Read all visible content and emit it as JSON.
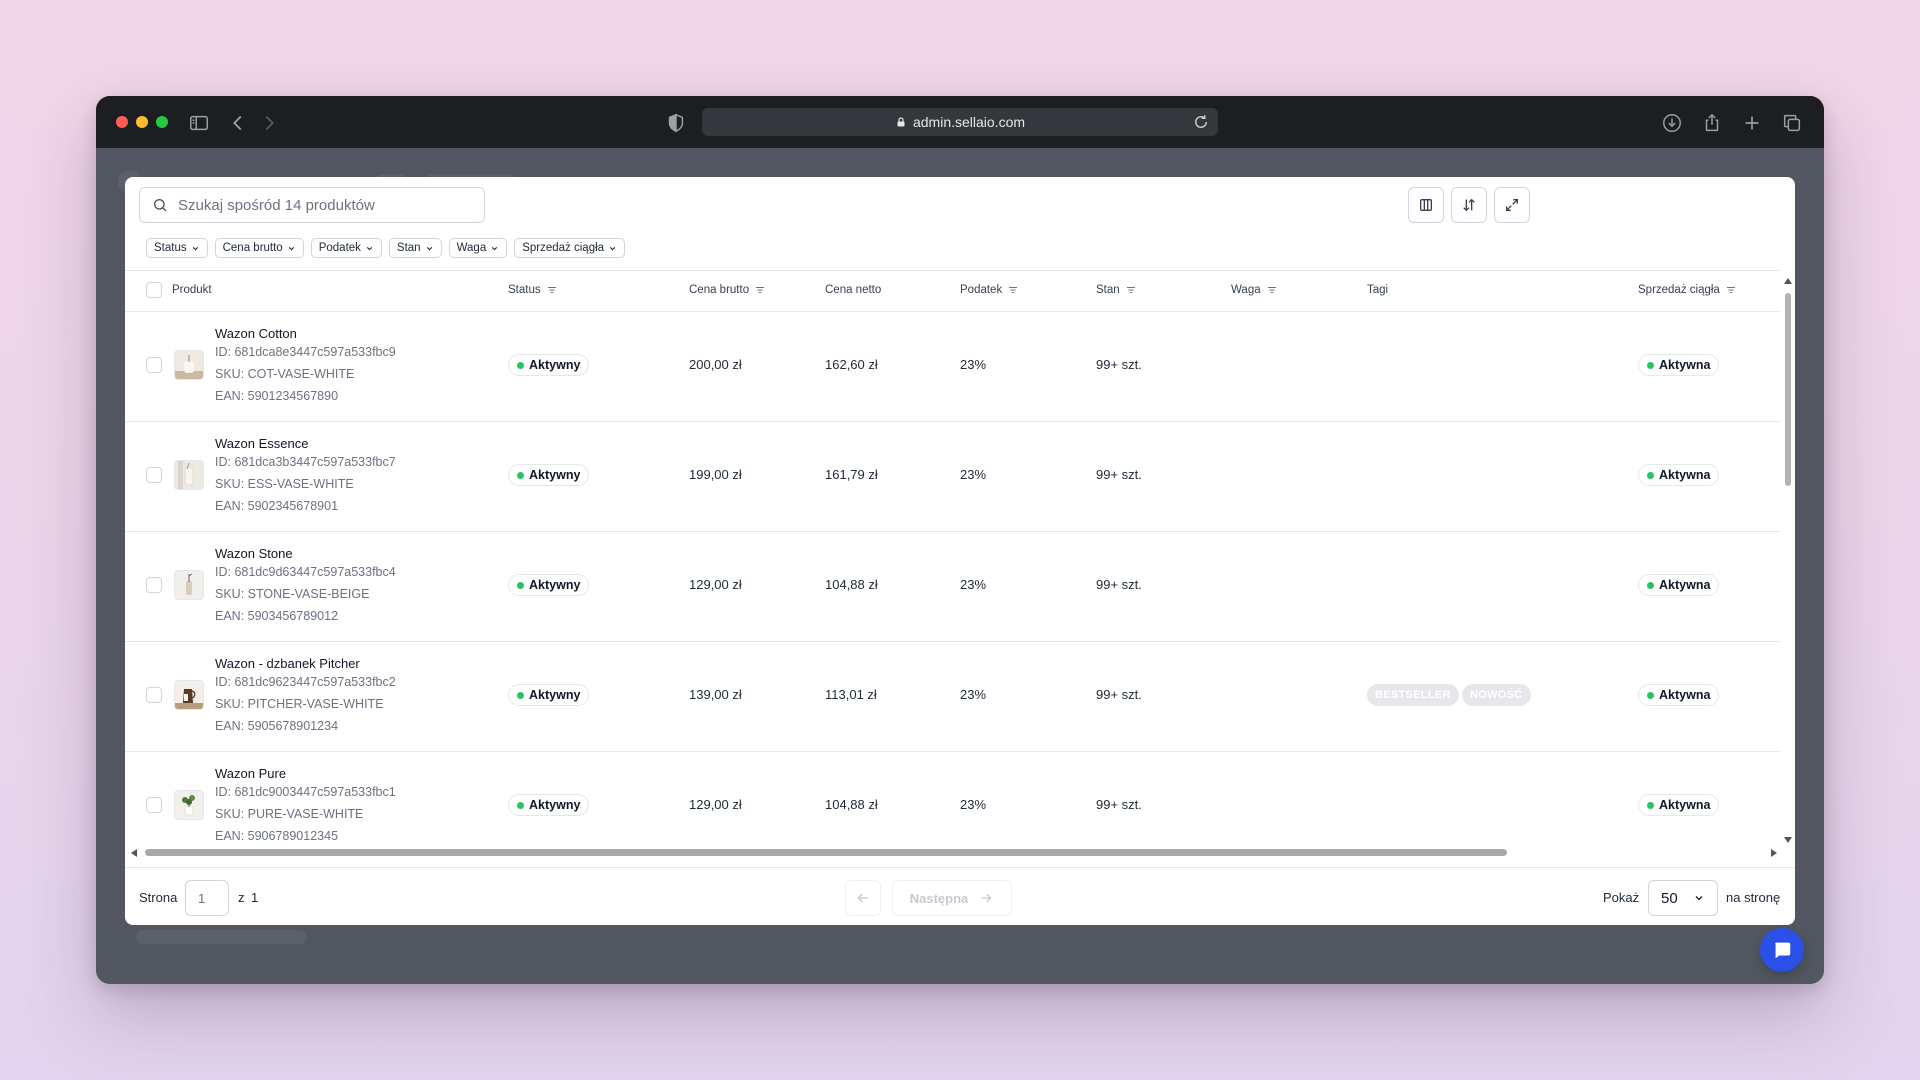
{
  "browser": {
    "url": "admin.sellaio.com"
  },
  "toolbar": {
    "search_placeholder": "Szukaj spośród 14 produktów"
  },
  "filters": [
    "Status",
    "Cena brutto",
    "Podatek",
    "Stan",
    "Waga",
    "Sprzedaż ciągła"
  ],
  "columns": {
    "product": "Produkt",
    "status": "Status",
    "gross": "Cena brutto",
    "net": "Cena netto",
    "tax": "Podatek",
    "stock": "Stan",
    "weight": "Waga",
    "tags": "Tagi",
    "continuous": "Sprzedaż ciągła"
  },
  "rows": [
    {
      "name": "Wazon Cotton",
      "id": "ID: 681dca8e3447c597a533fbc9",
      "sku": "SKU: COT-VASE-WHITE",
      "ean": "EAN: 5901234567890",
      "status": "Aktywny",
      "gross": "200,00 zł",
      "net": "162,60 zł",
      "tax": "23%",
      "stock": "99+ szt.",
      "continuous": "Aktywna",
      "tags": []
    },
    {
      "name": "Wazon Essence",
      "id": "ID: 681dca3b3447c597a533fbc7",
      "sku": "SKU: ESS-VASE-WHITE",
      "ean": "EAN: 5902345678901",
      "status": "Aktywny",
      "gross": "199,00 zł",
      "net": "161,79 zł",
      "tax": "23%",
      "stock": "99+ szt.",
      "continuous": "Aktywna",
      "tags": []
    },
    {
      "name": "Wazon Stone",
      "id": "ID: 681dc9d63447c597a533fbc4",
      "sku": "SKU: STONE-VASE-BEIGE",
      "ean": "EAN: 5903456789012",
      "status": "Aktywny",
      "gross": "129,00 zł",
      "net": "104,88 zł",
      "tax": "23%",
      "stock": "99+ szt.",
      "continuous": "Aktywna",
      "tags": []
    },
    {
      "name": "Wazon - dzbanek Pitcher",
      "id": "ID: 681dc9623447c597a533fbc2",
      "sku": "SKU: PITCHER-VASE-WHITE",
      "ean": "EAN: 5905678901234",
      "status": "Aktywny",
      "gross": "139,00 zł",
      "net": "113,01 zł",
      "tax": "23%",
      "stock": "99+ szt.",
      "continuous": "Aktywna",
      "tags": [
        "BESTSELLER",
        "NOWOŚĆ"
      ]
    },
    {
      "name": "Wazon Pure",
      "id": "ID: 681dc9003447c597a533fbc1",
      "sku": "SKU: PURE-VASE-WHITE",
      "ean": "EAN: 5906789012345",
      "status": "Aktywny",
      "gross": "129,00 zł",
      "net": "104,88 zł",
      "tax": "23%",
      "stock": "99+ szt.",
      "continuous": "Aktywna",
      "tags": []
    }
  ],
  "pagination": {
    "page_label": "Strona",
    "page_value": "1",
    "of_label": "z",
    "total_pages": "1",
    "next_label": "Następna",
    "show_label": "Pokaż",
    "per_page": "50",
    "per_page_suffix": "na stronę"
  },
  "colors": {
    "status_dot": "#22c55e",
    "chat_button": "#2a50e8"
  }
}
